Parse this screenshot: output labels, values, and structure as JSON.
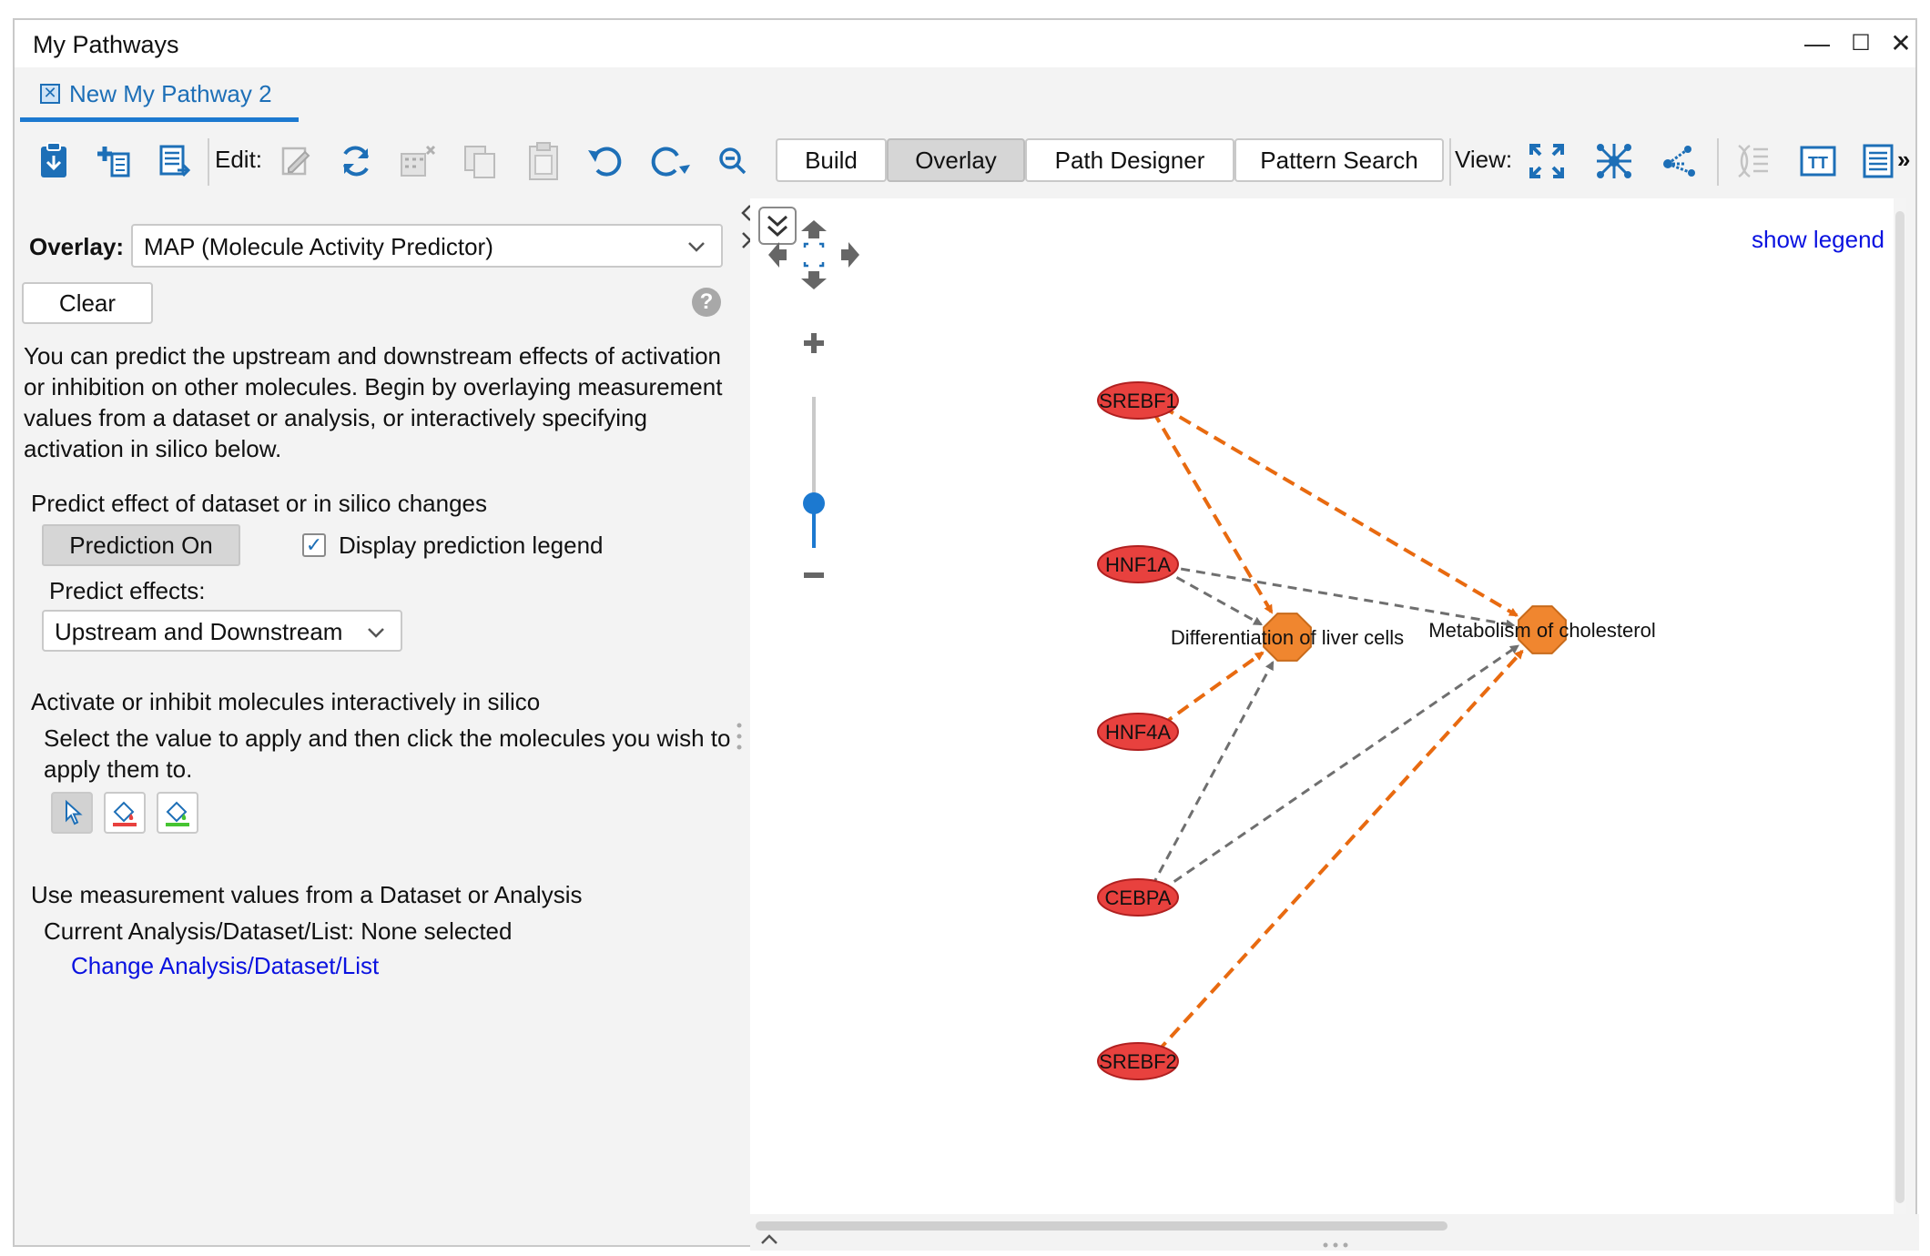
{
  "window": {
    "title": "My Pathways",
    "minimize": "—",
    "maximize": "☐",
    "close": "✕"
  },
  "tab": {
    "label": "New My Pathway 2",
    "close_glyph": "✕"
  },
  "toolbar": {
    "edit_label": "Edit:",
    "view_label": "View:",
    "modes": [
      "Build",
      "Overlay",
      "Path Designer",
      "Pattern Search"
    ],
    "active_mode": "Overlay",
    "more": "»"
  },
  "overlay": {
    "label": "Overlay:",
    "selected": "MAP (Molecule Activity Predictor)",
    "clear_label": "Clear",
    "help": "?",
    "intro": "You can predict the upstream and downstream effects of activation or inhibition on other molecules. Begin by overlaying measurement values from a dataset or analysis, or interactively specifying activation in silico below."
  },
  "predict": {
    "heading": "Predict effect of dataset or in silico changes",
    "button_label": "Prediction On",
    "legend_checkbox_label": "Display prediction legend",
    "legend_checked": true,
    "effects_label": "Predict effects:",
    "effects_selected": "Upstream and Downstream"
  },
  "activate": {
    "heading": "Activate or inhibit molecules interactively in silico",
    "description": "Select the value to apply and then click the molecules you wish to apply them to."
  },
  "measure": {
    "heading": "Use measurement values from a Dataset or Analysis",
    "current": "Current Analysis/Dataset/List: None selected",
    "change_link": "Change Analysis/Dataset/List"
  },
  "canvas": {
    "show_legend": "show legend",
    "zoom_level": 0.75
  },
  "network": {
    "colors": {
      "node_red": "#e8413e",
      "node_orange": "#f0862f",
      "edge_orange": "#e86a10",
      "edge_gray": "#6f6f6f"
    },
    "nodes": [
      {
        "id": "SREBF1",
        "label": "SREBF1",
        "type": "molecule"
      },
      {
        "id": "HNF1A",
        "label": "HNF1A",
        "type": "molecule"
      },
      {
        "id": "HNF4A",
        "label": "HNF4A",
        "type": "molecule"
      },
      {
        "id": "CEBPA",
        "label": "CEBPA",
        "type": "molecule"
      },
      {
        "id": "SREBF2",
        "label": "SREBF2",
        "type": "molecule"
      },
      {
        "id": "DLC",
        "label": "Differentiation of liver cells",
        "type": "function"
      },
      {
        "id": "MOC",
        "label": "Metabolism of cholesterol",
        "type": "function"
      }
    ],
    "edges": [
      {
        "from": "SREBF1",
        "to": "DLC",
        "color": "orange"
      },
      {
        "from": "SREBF1",
        "to": "MOC",
        "color": "orange"
      },
      {
        "from": "HNF1A",
        "to": "DLC",
        "color": "gray"
      },
      {
        "from": "HNF1A",
        "to": "MOC",
        "color": "gray"
      },
      {
        "from": "HNF4A",
        "to": "DLC",
        "color": "orange"
      },
      {
        "from": "CEBPA",
        "to": "DLC",
        "color": "gray"
      },
      {
        "from": "CEBPA",
        "to": "MOC",
        "color": "gray"
      },
      {
        "from": "SREBF2",
        "to": "MOC",
        "color": "orange"
      }
    ]
  }
}
